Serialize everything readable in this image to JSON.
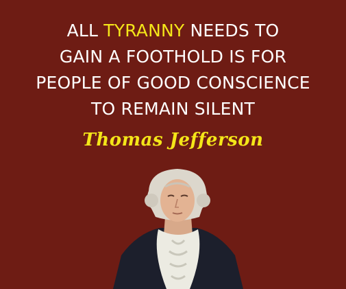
{
  "quote": {
    "line1_before": "ALL ",
    "line1_highlight": "TYRANNY",
    "line1_after": " NEEDS TO",
    "line2": "GAIN A FOOTHOLD IS FOR",
    "line3": "PEOPLE OF GOOD CONSCIENCE",
    "line4": "TO REMAIN SILENT"
  },
  "author": "Thomas Jefferson",
  "colors": {
    "background": "#6e1c14",
    "text": "#ffffff",
    "highlight": "#f4e619"
  },
  "portrait": {
    "icon": "portrait-illustration"
  }
}
